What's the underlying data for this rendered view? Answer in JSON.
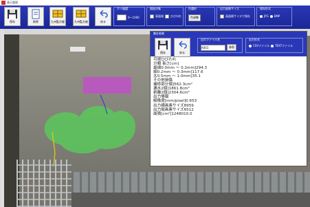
{
  "window": {
    "title": "表示管理"
  },
  "toolbar": {
    "buttons": [
      {
        "name": "save",
        "label": "保存",
        "icon": "floppy-disk-icon"
      },
      {
        "name": "delete",
        "label": "削除",
        "icon": "document-icon"
      },
      {
        "name": "crack-input",
        "label": "九州監方屋",
        "icon": "yellow-grid-icon"
      },
      {
        "name": "crack-output",
        "label": "九州監方座",
        "icon": "yellow-grid-icon"
      },
      {
        "name": "back",
        "label": "戻る",
        "icon": "undo-arrow-icon"
      }
    ],
    "range_group": {
      "title": "ポリ幅選",
      "value": "0〜1000"
    },
    "display_group": {
      "title": "描画対象",
      "opt1": "表面描",
      "opt2": "ひびわれ"
    },
    "color_group": {
      "title": "色選択",
      "button": "色調整"
    },
    "outsize_group": {
      "title": "出力画像サイズ",
      "opt": "画面格サイズで保存"
    },
    "format_group": {
      "title": "保存形式",
      "opt1": "JPG",
      "opt2": "BMP"
    }
  },
  "detail": {
    "title": "集計結果",
    "save_label": "保存",
    "back_label": "戻る",
    "file_group_title": "出力ファイル名",
    "file_value": "A001",
    "file_button": "参照",
    "format_group_title": "出力形式",
    "format_opt1": "CSVファイル",
    "format_opt2": "TEXTファイル"
  },
  "results": [
    "可視ひびわれ",
    "分類 長さ[cm]",
    "最細0.0mm 〜 0.2mm]294.3",
    "細0.2mm 〜 0.3mm]117.6",
    "太0.5mm 〜 1.0mm]35.1",
    "その他損傷",
    "補修部分個]562.3cm²",
    "漏水2個]1861.8cm²",
    "剥離2個]2304.6cm²",
    "出力情報",
    "解像度[mm/pixel]0.653",
    "出力横画素サイズ8959",
    "出力縦画素サイズ6512",
    "面積[cm²]1248010.0"
  ],
  "colors": {
    "toolbar": "#2a38b8",
    "crack_overlay": "#5ac85a",
    "patch_overlay": "#c050c8"
  }
}
